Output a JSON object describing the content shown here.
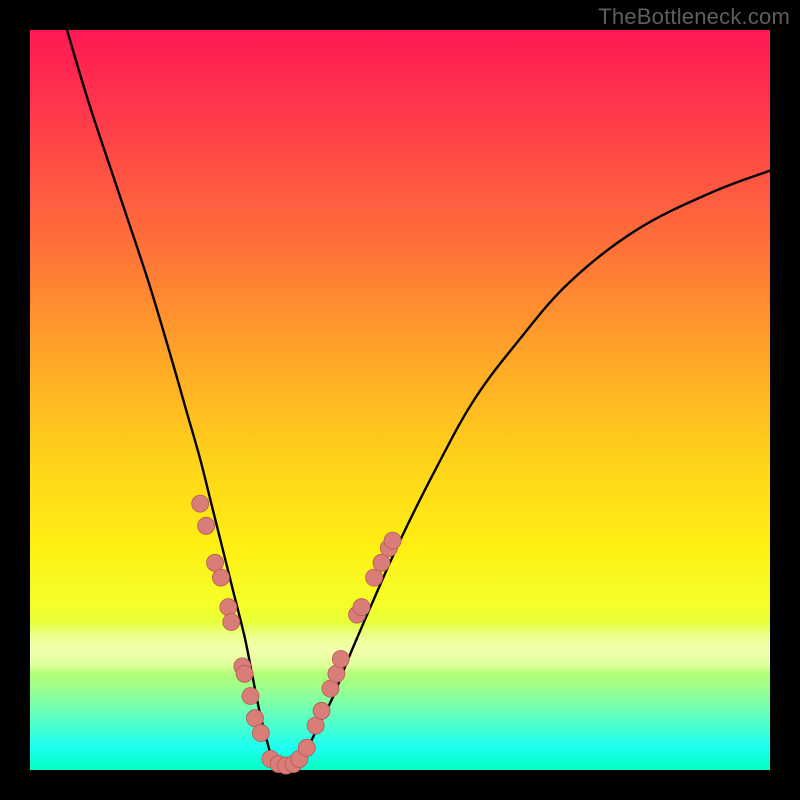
{
  "watermark": "TheBottleneck.com",
  "colors": {
    "frame": "#000000",
    "marker_fill": "#d97d78",
    "marker_stroke": "#b85a55",
    "curve": "#000000",
    "gradient_top": "#ff1854",
    "gradient_bottom": "#04ffc4"
  },
  "chart_data": {
    "type": "line",
    "title": "",
    "xlabel": "",
    "ylabel": "",
    "xlim": [
      0,
      100
    ],
    "ylim": [
      0,
      100
    ],
    "grid": false,
    "legend": false,
    "note": "Axes have no numeric tick labels; values estimated from pixel positions on a 0–100 normalized scale. y is the V-shaped curve height (0 at bottom).",
    "series": [
      {
        "name": "curve",
        "x": [
          5,
          8,
          12,
          16,
          19,
          21,
          23,
          24.5,
          26,
          27.5,
          29,
          30,
          31,
          32,
          33,
          34.5,
          36,
          37.5,
          39,
          41,
          43,
          46,
          50,
          55,
          60,
          66,
          73,
          82,
          92,
          100
        ],
        "y": [
          100,
          90,
          78,
          66,
          56,
          49,
          42,
          36,
          30,
          24,
          18,
          13,
          8,
          4,
          1,
          0,
          1,
          3,
          6,
          10,
          15,
          22,
          31,
          41,
          50,
          58,
          66,
          73,
          78,
          81
        ]
      }
    ],
    "markers": {
      "name": "highlighted-points",
      "note": "Salmon dots clustered along the lower portion of the V.",
      "points": [
        {
          "x": 23.0,
          "y": 36
        },
        {
          "x": 23.8,
          "y": 33
        },
        {
          "x": 25.0,
          "y": 28
        },
        {
          "x": 25.8,
          "y": 26
        },
        {
          "x": 26.8,
          "y": 22
        },
        {
          "x": 27.2,
          "y": 20
        },
        {
          "x": 28.7,
          "y": 14
        },
        {
          "x": 29.0,
          "y": 13
        },
        {
          "x": 29.8,
          "y": 10
        },
        {
          "x": 30.4,
          "y": 7
        },
        {
          "x": 31.2,
          "y": 5
        },
        {
          "x": 32.5,
          "y": 1.5
        },
        {
          "x": 33.6,
          "y": 0.8
        },
        {
          "x": 34.6,
          "y": 0.6
        },
        {
          "x": 35.6,
          "y": 0.8
        },
        {
          "x": 36.4,
          "y": 1.5
        },
        {
          "x": 37.4,
          "y": 3
        },
        {
          "x": 38.6,
          "y": 6
        },
        {
          "x": 39.4,
          "y": 8
        },
        {
          "x": 40.6,
          "y": 11
        },
        {
          "x": 41.4,
          "y": 13
        },
        {
          "x": 42.0,
          "y": 15
        },
        {
          "x": 44.2,
          "y": 21
        },
        {
          "x": 44.8,
          "y": 22
        },
        {
          "x": 46.5,
          "y": 26
        },
        {
          "x": 47.5,
          "y": 28
        },
        {
          "x": 48.5,
          "y": 30
        },
        {
          "x": 49.0,
          "y": 31
        }
      ]
    }
  }
}
